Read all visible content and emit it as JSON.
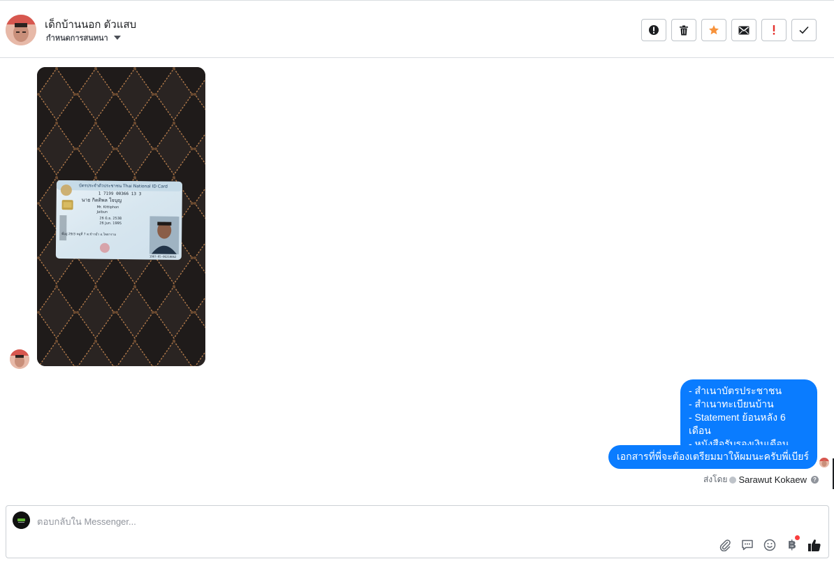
{
  "header": {
    "contact_name": "เด็กบ้านนอก ตัวแสบ",
    "subtitle": "กำหนดการสนทนา",
    "actions": [
      {
        "name": "report-icon"
      },
      {
        "name": "trash-icon"
      },
      {
        "name": "star-icon"
      },
      {
        "name": "mail-icon"
      },
      {
        "name": "exclamation-icon"
      },
      {
        "name": "checkmark-icon"
      }
    ]
  },
  "thread": {
    "photo_alt_text": "บัตรประจำตัวประชาชน Thai National ID Card",
    "outgoing_list_lines": [
      "- สำเนาบัตรประชาชน",
      "- สำเนาทะเบียนบ้าน",
      "- Statement ย้อนหลัง 6 เดือน",
      "- หนังสือรับรองเงินเดือน"
    ],
    "outgoing_message": "เอกสารที่พี่จะต้องเตรียมมาให้ผมนะครับพี่เบียร์",
    "sent_by_label": "ส่งโดย",
    "sent_by_name": "Sarawut Kokaew"
  },
  "composer": {
    "placeholder": "ตอบกลับใน Messenger...",
    "value": "",
    "tools": [
      "attach-icon",
      "saved-replies-icon",
      "emoji-icon",
      "baht-payment-icon",
      "thumbs-up-icon"
    ],
    "baht_symbol": "฿"
  },
  "colors": {
    "accent": "#0a7cff",
    "star": "#f7923b",
    "alert": "#e4322e",
    "notification": "#fa3e3e"
  }
}
